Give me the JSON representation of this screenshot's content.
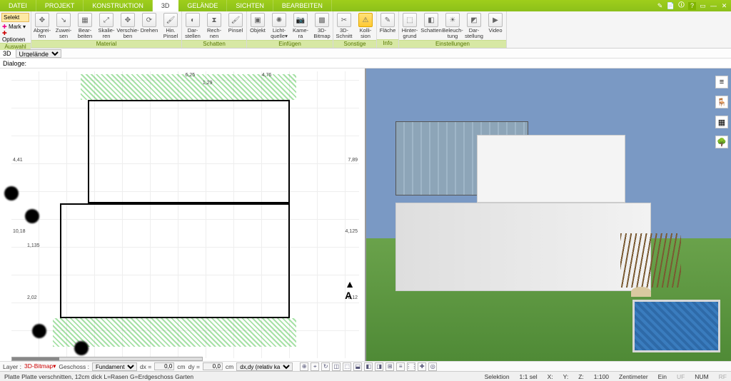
{
  "menu": {
    "items": [
      "DATEI",
      "PROJEKT",
      "KONSTRUKTION",
      "3D",
      "GELÄNDE",
      "SICHTEN",
      "BEARBEITEN"
    ],
    "active": "3D"
  },
  "win_icons": [
    "✎",
    "📄",
    "🛈",
    "?",
    "▭",
    "—",
    "✕"
  ],
  "ribbon": {
    "left": {
      "selekt": "Selekt",
      "mark": "Mark ▾",
      "optionen": "Optionen",
      "label": "Auswahl"
    },
    "groups": [
      {
        "label": "Material",
        "buttons": [
          {
            "id": "abgreifen",
            "lbl": "Abgrei-\nfen",
            "glyph": "✥"
          },
          {
            "id": "zuweisen",
            "lbl": "Zuwei-\nsen",
            "glyph": "↘"
          },
          {
            "id": "bearbeiten",
            "lbl": "Bear-\nbeiten",
            "glyph": "▦"
          },
          {
            "id": "skalieren",
            "lbl": "Skalie-\nren",
            "glyph": "⤢"
          },
          {
            "id": "verschieben",
            "lbl": "Verschie-\nben",
            "glyph": "✥"
          },
          {
            "id": "drehen",
            "lbl": "Drehen",
            "glyph": "⟳"
          },
          {
            "id": "hin-pinsel",
            "lbl": "Hin.\nPinsel",
            "glyph": "🖌"
          }
        ]
      },
      {
        "label": "Schatten",
        "buttons": [
          {
            "id": "dar-stellen",
            "lbl": "Dar-\nstellen",
            "glyph": "◐"
          },
          {
            "id": "rech-nen",
            "lbl": "Rech-\nnen",
            "glyph": "⧗"
          },
          {
            "id": "pinsel",
            "lbl": "Pinsel",
            "glyph": "🖌"
          }
        ]
      },
      {
        "label": "Einfügen",
        "buttons": [
          {
            "id": "objekt",
            "lbl": "Objekt",
            "glyph": "▣"
          },
          {
            "id": "lichtquelle",
            "lbl": "Licht-\nquelle▾",
            "glyph": "✺"
          },
          {
            "id": "kamera",
            "lbl": "Kame-\nra",
            "glyph": "📷"
          },
          {
            "id": "3d-bitmap",
            "lbl": "3D-\nBitmap",
            "glyph": "▩"
          }
        ]
      },
      {
        "label": "Sonstige",
        "buttons": [
          {
            "id": "3d-schnitt",
            "lbl": "3D-\nSchnitt",
            "glyph": "✂"
          },
          {
            "id": "kollision",
            "lbl": "Kolli-\nsion",
            "glyph": "⚠",
            "hl": true
          }
        ]
      },
      {
        "label": "Info",
        "buttons": [
          {
            "id": "flaeche",
            "lbl": "Fläche",
            "glyph": "✎"
          }
        ]
      },
      {
        "label": "Einstellungen",
        "buttons": [
          {
            "id": "hintergrund",
            "lbl": "Hinter-\ngrund",
            "glyph": "⬚"
          },
          {
            "id": "schatten",
            "lbl": "Schatten",
            "glyph": "◧"
          },
          {
            "id": "beleuchtung",
            "lbl": "Beleuch-\ntung",
            "glyph": "☀"
          },
          {
            "id": "darstellung",
            "lbl": "Dar-\nstellung",
            "glyph": "◩"
          },
          {
            "id": "video",
            "lbl": "Video",
            "glyph": "▶"
          }
        ]
      }
    ]
  },
  "subbar": {
    "mode": "3D",
    "layer": "Urgelände"
  },
  "dialoge": "Dialoge:",
  "plan": {
    "dims": [
      "6,25",
      "4,76",
      "1,29",
      "4,41",
      "10,18",
      "1,135",
      "2,02",
      "7,89",
      "4,125",
      "6,12"
    ],
    "compass": "A"
  },
  "side_tools": [
    "≡",
    "🪑",
    "▦",
    "🌳"
  ],
  "bottombar": {
    "layer_label": "Layer :",
    "layer_value": "3D-Bitmap▾",
    "geschoss_label": "Geschoss :",
    "geschoss_value": "Fundament",
    "dx_label": "dx =",
    "dx_value": "0,0",
    "cm": "cm",
    "dy_label": "dy =",
    "dy_value": "0,0",
    "mode": "dx,dy (relativ ka",
    "tool_icons": [
      "⊕",
      "⌖",
      "↻",
      "◫",
      "⬚",
      "⬓",
      "◧",
      "◨",
      "⊞",
      "≡",
      "⋮⋮",
      "✚",
      "◎"
    ]
  },
  "status": {
    "hint": "Platte Platte verschnitten, 12cm dick L=Rasen G=Erdgeschoss Garten",
    "selektion": "Selektion",
    "scale1": "1:1 sel",
    "x": "X:",
    "y": "Y:",
    "z": "Z:",
    "scale2": "1:100",
    "unit": "Zentimeter",
    "ein": "Ein",
    "uf": "UF",
    "num": "NUM",
    "rf": "RF"
  }
}
